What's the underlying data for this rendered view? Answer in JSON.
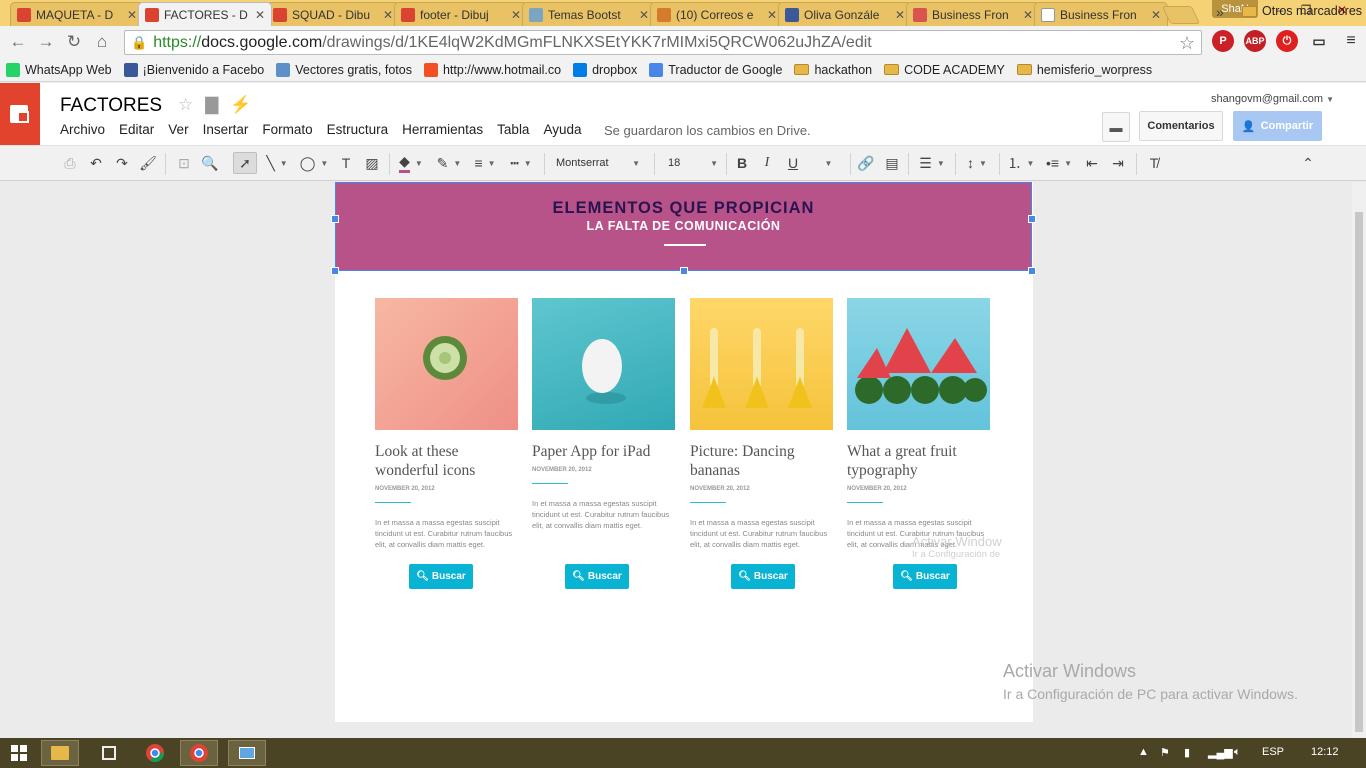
{
  "browser": {
    "tabs": [
      {
        "title": "MAQUETA - D",
        "color": "#d9432f"
      },
      {
        "title": "FACTORES - D",
        "color": "#d9432f",
        "active": true
      },
      {
        "title": "SQUAD - Dibu",
        "color": "#d9432f"
      },
      {
        "title": "footer - Dibuj",
        "color": "#d9432f"
      },
      {
        "title": "Temas Bootst",
        "color": "#7aa6c2"
      },
      {
        "title": "(10) Correos e",
        "color": "#d47b2c"
      },
      {
        "title": "Oliva Gonzále",
        "color": "#3b5998"
      },
      {
        "title": "Business Fron",
        "color": "#d9534f"
      },
      {
        "title": "Business Fron",
        "color": "#ffffff"
      }
    ],
    "user_badge": "ShaN",
    "window_controls": [
      "–",
      "❐",
      "✕"
    ],
    "url": {
      "scheme": "https://",
      "host": "docs.google.com",
      "path": "/drawings/d/1KE4lqW2KdMGmFLNKXSEtYKK7rMIMxi5QRCW062uJhZA/edit"
    },
    "extension_icons": [
      "P",
      "ABP",
      "⏻"
    ],
    "bookmarks": [
      {
        "label": "WhatsApp Web",
        "icon": "whatsapp-icon",
        "color": "#25d366"
      },
      {
        "label": "¡Bienvenido a Facebo",
        "icon": "facebook-icon",
        "color": "#3b5998"
      },
      {
        "label": "Vectores gratis, fotos",
        "icon": "freepik-icon",
        "color": "#5d8fc9"
      },
      {
        "label": "http://www.hotmail.co",
        "icon": "windows-icon",
        "color": "#f25022"
      },
      {
        "label": "dropbox",
        "icon": "dropbox-icon",
        "color": "#007ee5"
      },
      {
        "label": "Traductor de Google",
        "icon": "translate-icon",
        "color": "#4a86e8"
      },
      {
        "label": "hackathon",
        "icon": "folder-icon",
        "color": "#e6b84a"
      },
      {
        "label": "CODE ACADEMY",
        "icon": "folder-icon",
        "color": "#e6b84a"
      },
      {
        "label": "hemisferio_worpress",
        "icon": "folder-icon",
        "color": "#e6b84a"
      }
    ],
    "bookmarks_more": "»",
    "other_bookmarks": "Otros marcadores"
  },
  "app": {
    "doc_title": "FACTORES",
    "menu": [
      "Archivo",
      "Editar",
      "Ver",
      "Insertar",
      "Formato",
      "Estructura",
      "Herramientas",
      "Tabla",
      "Ayuda"
    ],
    "save_status": "Se guardaron los cambios en Drive.",
    "account": "shangovm@gmail.com",
    "comments_label": "Comentarios",
    "share_label": "Compartir",
    "font_name": "Montserrat",
    "font_size": "18",
    "accent_color": "#e1432c"
  },
  "drawing": {
    "banner_title": "ELEMENTOS QUE PROPICIAN",
    "banner_subtitle": "LA FALTA DE COMUNICACIÓN",
    "banner_color": "#b8538a",
    "cards": [
      {
        "title": "Look at these wonderful icons",
        "date": "NOVEMBER 20, 2012",
        "text": "In et massa a massa egestas suscipit tincidunt ut est. Curabitur rutrum faucibus elit, at convallis diam mattis eget.",
        "button": "Buscar",
        "image": "cucumber-on-pink"
      },
      {
        "title": "Paper App for iPad",
        "date": "NOVEMBER 20, 2012",
        "text": "In et massa a massa egestas suscipit tincidunt ut est. Curabitur rutrum faucibus elit, at convallis diam mattis eget.",
        "button": "Buscar",
        "image": "egg-on-teal"
      },
      {
        "title": "Picture: Dancing bananas",
        "date": "NOVEMBER 20, 2012",
        "text": "In et massa a massa egestas suscipit tincidunt ut est. Curabitur rutrum faucibus elit, at convallis diam mattis eget.",
        "button": "Buscar",
        "image": "bananas-on-yellow"
      },
      {
        "title": "What a great fruit typography",
        "date": "NOVEMBER 20, 2012",
        "text": "In et massa a massa egestas suscipit tincidunt ut est. Curabitur rutrum faucibus elit, at convallis diam mattis eget.",
        "button": "Buscar",
        "image": "watermelon-on-blue"
      }
    ],
    "inner_watermark": [
      "Activar Window",
      "Ir a Configuración de"
    ]
  },
  "watermark": {
    "line1": "Activar Windows",
    "line2": "Ir a Configuración de PC para activar Windows."
  },
  "taskbar": {
    "language": "ESP",
    "time": "12:12"
  }
}
